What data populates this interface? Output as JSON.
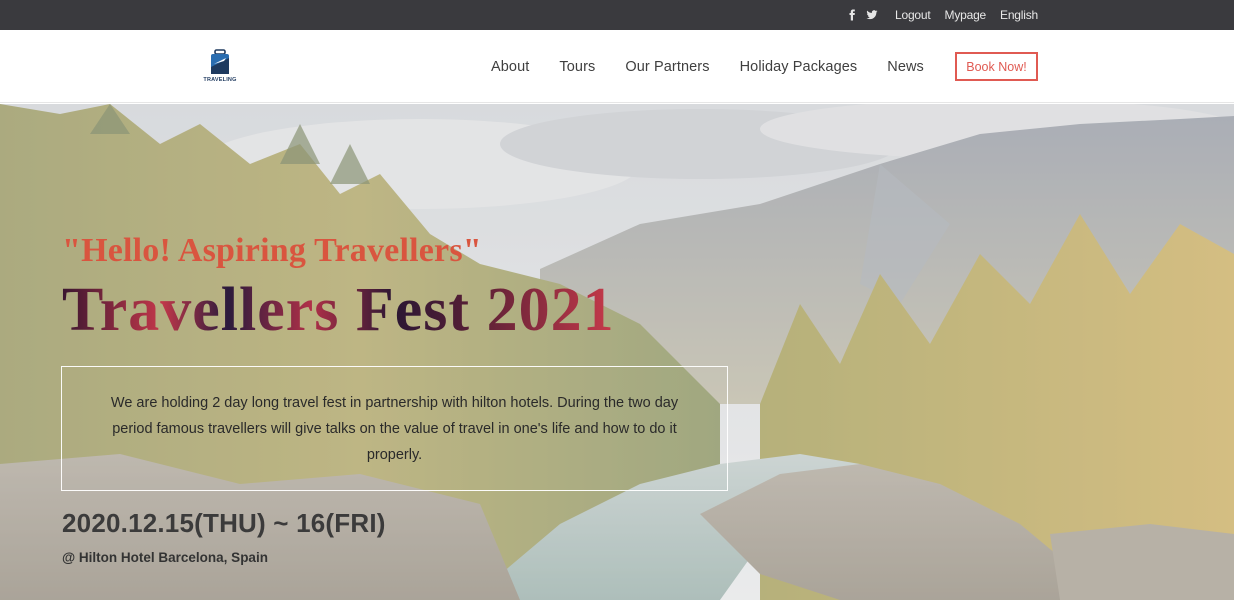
{
  "topbar": {
    "social": [
      {
        "icon": "facebook-icon"
      },
      {
        "icon": "twitter-icon"
      }
    ],
    "links": {
      "logout": "Logout",
      "mypage": "Mypage",
      "language": "English"
    }
  },
  "header": {
    "logo_text": "TRAVELING",
    "nav": {
      "about": "About",
      "tours": "Tours",
      "partners": "Our Partners",
      "packages": "Holiday Packages",
      "news": "News"
    },
    "book_button": "Book Now!"
  },
  "hero": {
    "greeting": "\"Hello! Aspiring Travellers\"",
    "title": "Travellers Fest 2021",
    "description": "We are holding 2 day long travel fest in partnership with hilton hotels. During the two day period famous travellers will give talks on the value of travel in one's life and how to do it properly.",
    "date": "2020.12.15(THU) ~ 16(FRI)",
    "venue": "@ Hilton Hotel Barcelona, Spain"
  },
  "colors": {
    "topbar_bg": "#3a3a3e",
    "accent": "#e05a52",
    "greeting": "#d9553f"
  }
}
